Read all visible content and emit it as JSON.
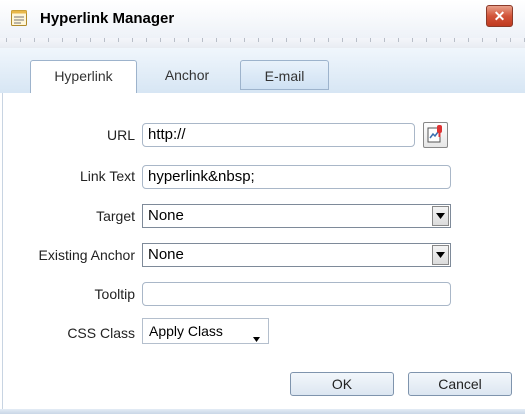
{
  "window": {
    "title": "Hyperlink Manager",
    "close_glyph": "✕"
  },
  "tabs": [
    {
      "label": "Hyperlink",
      "active": true
    },
    {
      "label": "Anchor",
      "active": false
    },
    {
      "label": "E-mail",
      "active": false
    }
  ],
  "form": {
    "url": {
      "label": "URL",
      "value": "http://"
    },
    "link_text": {
      "label": "Link Text",
      "value": "hyperlink&nbsp;"
    },
    "target": {
      "label": "Target",
      "selected": "None"
    },
    "existing_anchor": {
      "label": "Existing Anchor",
      "selected": "None"
    },
    "tooltip": {
      "label": "Tooltip",
      "value": ""
    },
    "css_class": {
      "label": "CSS Class",
      "selected": "Apply Class"
    }
  },
  "buttons": {
    "ok": "OK",
    "cancel": "Cancel"
  },
  "icons": {
    "app": "document-icon",
    "url_browse": "link-browse-icon",
    "dropdown": "dropdown-arrow-icon"
  },
  "colors": {
    "accent": "#d2543a",
    "tab_band": "#d7e6f4",
    "border": "#9db3cc"
  }
}
